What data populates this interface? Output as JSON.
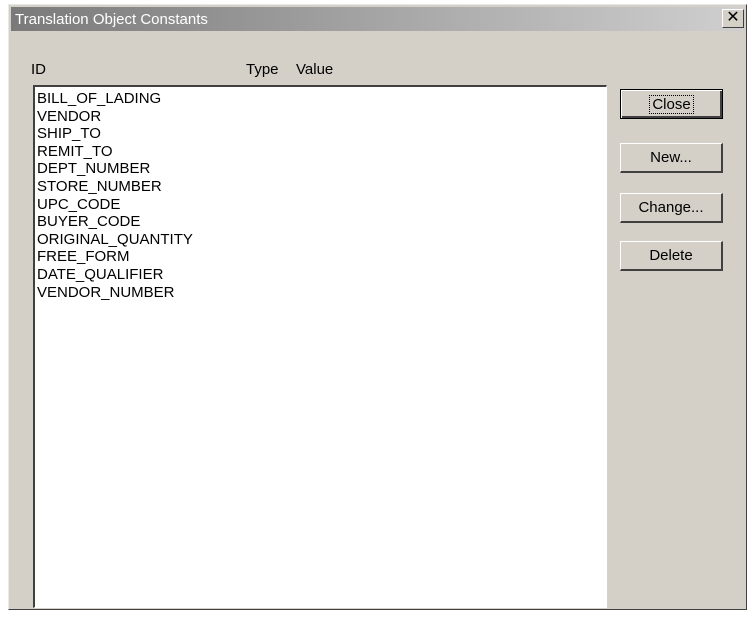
{
  "window": {
    "title": "Translation Object Constants",
    "close_glyph": "✕"
  },
  "columns": {
    "id": "ID",
    "type": "Type",
    "value": "Value"
  },
  "list": {
    "items": [
      "BILL_OF_LADING",
      "VENDOR",
      "SHIP_TO",
      "REMIT_TO",
      "DEPT_NUMBER",
      "STORE_NUMBER",
      "UPC_CODE",
      "BUYER_CODE",
      "ORIGINAL_QUANTITY",
      "FREE_FORM",
      "DATE_QUALIFIER",
      "VENDOR_NUMBER"
    ]
  },
  "buttons": {
    "close": "Close",
    "new": "New...",
    "change": "Change...",
    "delete": "Delete"
  }
}
